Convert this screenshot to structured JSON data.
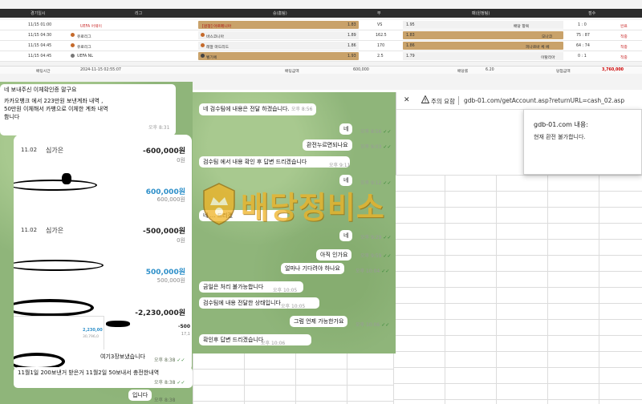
{
  "betting": {
    "topbar": [
      "",
      "",
      ""
    ],
    "headers": [
      "경기일시",
      "리그",
      "승(홈팀)",
      "무",
      "패(원정팀)",
      "점수"
    ],
    "rows": [
      {
        "date": "11/15 01:00",
        "league": "UEFA 어웨이",
        "home": "[원정] 아르메니아",
        "home_odds": "1.83",
        "draw": "VS",
        "draw_odds": "",
        "away_odds": "1.95",
        "away": "배당 항목",
        "score": "1 : 0",
        "status": "완료"
      },
      {
        "date": "11/15 04:30",
        "league": "유로리그",
        "home": "바스코니아",
        "home_odds": "1.89",
        "draw": "162.5",
        "draw_odds": "",
        "away_odds": "1.83",
        "away": "모나코",
        "score": "75 : 87",
        "status": "적중"
      },
      {
        "date": "11/15 04:45",
        "league": "유로리그",
        "home": "레알 마드리드",
        "home_odds": "1.86",
        "draw": "170",
        "draw_odds": "",
        "away_odds": "1.86",
        "away": "피나르바 체 베",
        "score": "64 : 74",
        "status": "적중"
      },
      {
        "date": "11/15 04:45",
        "league": "UEFA NL",
        "home": "벨기에",
        "home_odds": "1.93",
        "draw": "2.5",
        "draw_odds": "",
        "away_odds": "1.79",
        "away": "이탈리아",
        "score": "0 : 1",
        "status": "적중"
      }
    ],
    "footer": {
      "bet_time_label": "배팅시간",
      "bet_time": "2024-11-15 02:55:07",
      "bet_amount_label": "배팅금액",
      "bet_amount": "600,000",
      "odds_label": "배당률",
      "odds": "6.20",
      "win_label": "당첨금액",
      "win_amount": "3,760,000"
    }
  },
  "chat_left": {
    "top_bubble": [
      "네 보내주신 이체확인증 말구요",
      "",
      "카카오뱅크 에서 223만원 보낸계좌 내역 ,",
      "50만원 이체해서 카뱅으로 이체한 계좌 내역",
      "함니다"
    ],
    "top_time": "오후 8:31",
    "bank": [
      {
        "date": "11.02",
        "name": "심가은",
        "amount": "-600,000원",
        "sub": "0원"
      },
      {
        "amount": "600,000원",
        "sub": "600,000원"
      },
      {
        "date": "11.02",
        "name": "심가은",
        "amount": "-500,000원",
        "sub": "0원"
      },
      {
        "amount": "500,000원",
        "sub": "500,000원"
      },
      {
        "amount": "-2,230,000원"
      },
      {
        "amount": "-500",
        "sub": "17,1"
      },
      {
        "amount": "2,230,00",
        "sub": "30,796,0"
      }
    ],
    "msg1": "여기3장보냈습니다",
    "msg1_time": "오후 8:38",
    "msg2": "11월1일 200보낸거 받은거 11월2일 50보내서 충전한내역",
    "msg2_time": "오후 8:38",
    "msg3": "입니다",
    "msg3_time": "오후 8:38"
  },
  "chat_mid": {
    "messages": [
      {
        "text": "네 검수팀에 내용은 전달 하겠습니다.",
        "time": "오후 8:56",
        "side": "left"
      },
      {
        "text": "네",
        "time": "오후 8:56",
        "side": "right"
      },
      {
        "text": "환전누르면되나요",
        "time": "오후 9:03",
        "side": "right"
      },
      {
        "text": "검수팀 에서 내용 확인 후 답변 드리겠습니다",
        "time": "오후 9:11",
        "side": "left"
      },
      {
        "text": "네",
        "time": "오후 9:12",
        "side": "right"
      },
      {
        "text": "네 ... 드리겠",
        "time": "",
        "side": "left"
      },
      {
        "text": "네",
        "time": "오후 9:29",
        "side": "right"
      },
      {
        "text": "아직 인가요",
        "time": "오후 9:59",
        "side": "right"
      },
      {
        "text": "얼마나 기다려야 하나요",
        "time": "오후 10:04",
        "side": "right"
      },
      {
        "text": "금일은 처리 불가능합니다",
        "time": "오후 10:05",
        "side": "left"
      },
      {
        "text": "검수팀에 내용 전달한 상태입니다",
        "time": "오후 10:05",
        "side": "left"
      },
      {
        "text": "그럼 언제 가능한가요",
        "time": "오후 10:06",
        "side": "right"
      },
      {
        "text": "확인후 답변 드리겠습니다",
        "time": "오후 10:06",
        "side": "left"
      }
    ]
  },
  "browser": {
    "warning_label": "주의 요함",
    "url": "gdb-01.com/getAccount.asp?returnURL=cash_02.asp",
    "dialog_title": "gdb-01.com 내용:",
    "dialog_message": "현재 환전 불가합니다."
  },
  "watermark": {
    "text": "배당정비소"
  },
  "colors": {
    "chat_bg": "#8fb57a",
    "gold_cell": "#c9a26a",
    "watermark": "#f0b223",
    "blue_amount": "#2d8fc9"
  }
}
